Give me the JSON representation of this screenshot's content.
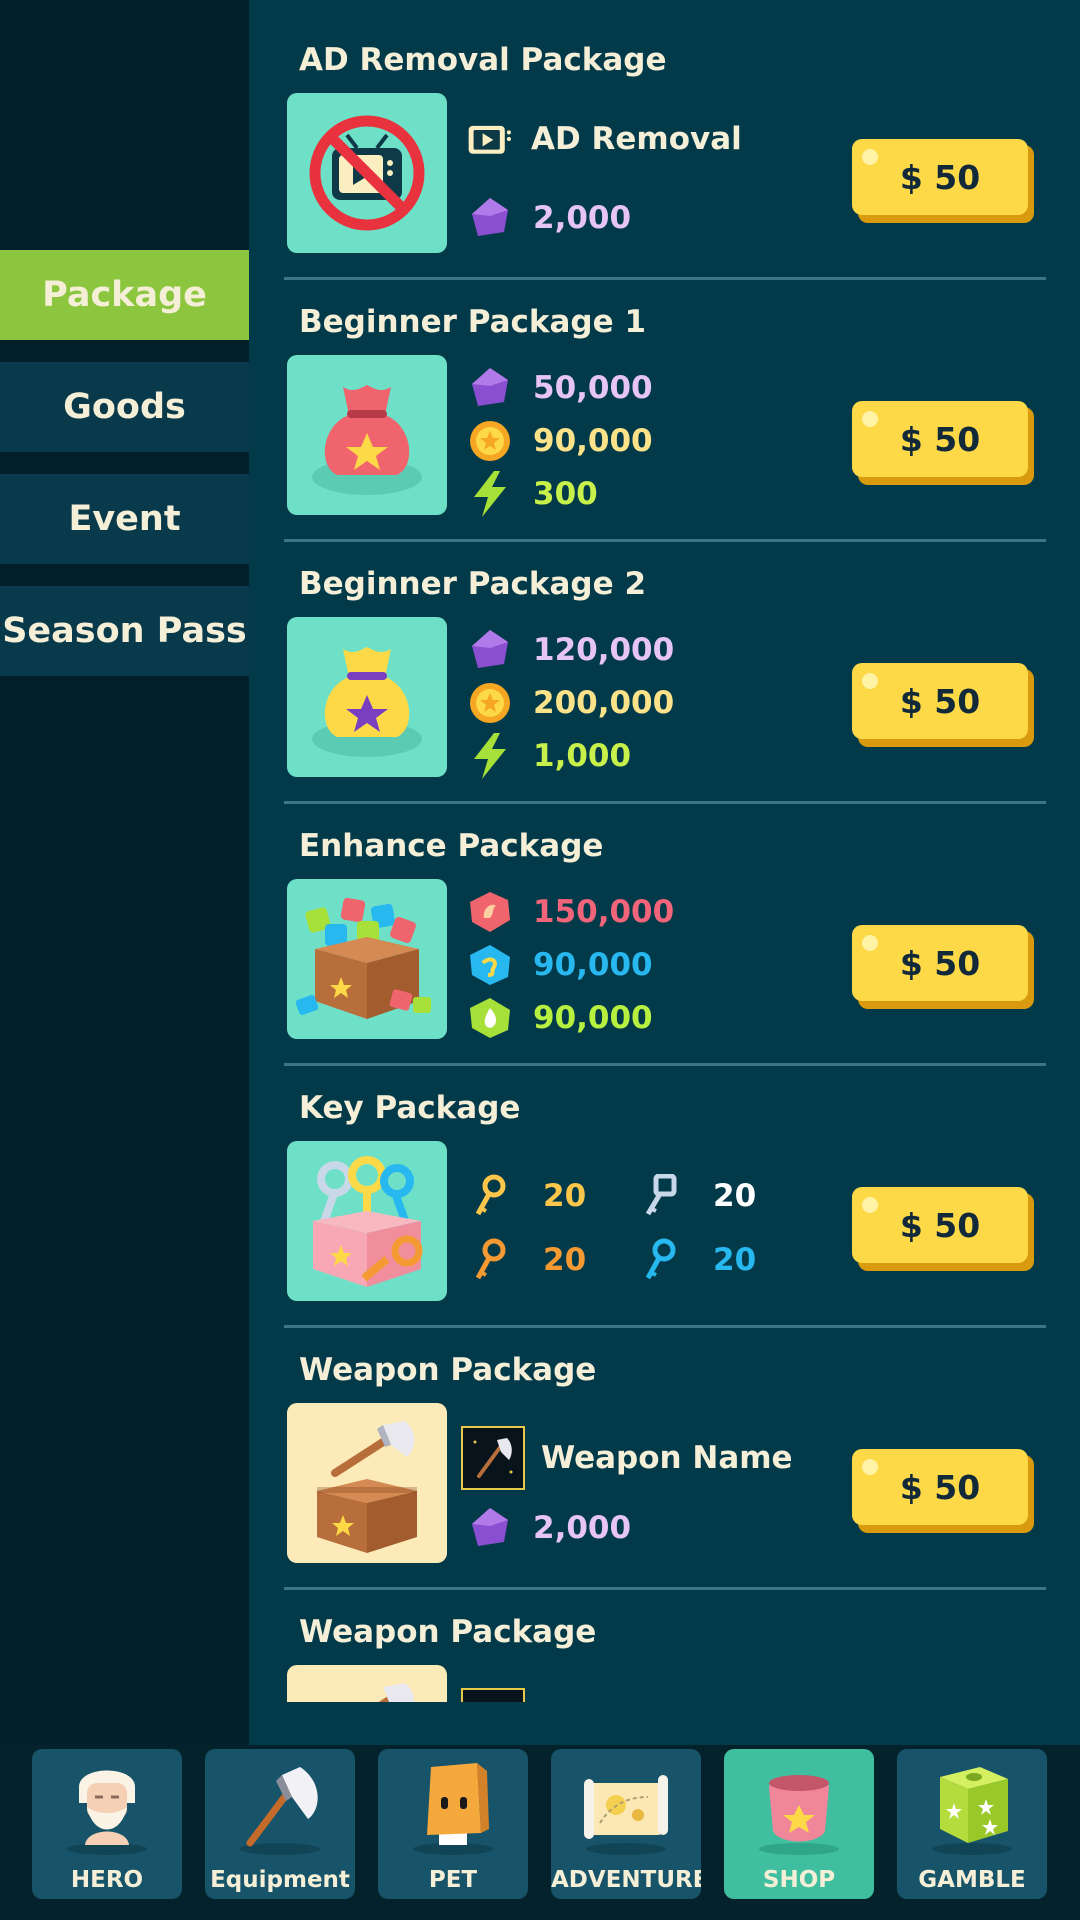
{
  "sidebar": {
    "tabs": [
      {
        "label": "Package",
        "active": true
      },
      {
        "label": "Goods",
        "active": false
      },
      {
        "label": "Event",
        "active": false
      },
      {
        "label": "Season Pass",
        "active": false
      }
    ]
  },
  "packages": [
    {
      "title": "AD Removal Package",
      "thumb": "no-ads-tv-icon",
      "item_label": "AD Removal",
      "gems": "2,000",
      "price": "$ 50"
    },
    {
      "title": "Beginner Package 1",
      "thumb": "red-pouch-icon",
      "gems": "50,000",
      "coins": "90,000",
      "energy": "300",
      "price": "$ 50"
    },
    {
      "title": "Beginner Package 2",
      "thumb": "gold-pouch-icon",
      "gems": "120,000",
      "coins": "200,000",
      "energy": "1,000",
      "price": "$ 50"
    },
    {
      "title": "Enhance Package",
      "thumb": "enhance-box-icon",
      "red_stone": "150,000",
      "blue_stone": "90,000",
      "green_stone": "90,000",
      "price": "$ 50"
    },
    {
      "title": "Key Package",
      "thumb": "key-box-icon",
      "gold_key": "20",
      "silver_key": "20",
      "orange_key": "20",
      "blue_key": "20",
      "price": "$ 50"
    },
    {
      "title": "Weapon Package",
      "thumb": "axe-box-icon",
      "item_label": "Weapon Name",
      "gems": "2,000",
      "price": "$ 50"
    },
    {
      "title": "Weapon Package"
    }
  ],
  "colors": {
    "gem": "#e6c4f5",
    "coin": "#fce38a",
    "energy": "#c8f04a",
    "red_stone": "#f2647a",
    "blue_stone": "#28b8f0",
    "green_stone": "#b8f040",
    "gold_key": "#fcc64a",
    "silver_key": "#ffffff",
    "orange_key": "#f59a32",
    "blue_key": "#28b8f0",
    "active_tab": "#8cc63f",
    "buy_button": "#fdd947"
  },
  "bottom_nav": [
    {
      "label": "HERO",
      "icon": "hero-icon",
      "active": false
    },
    {
      "label": "Equipment",
      "icon": "axe-icon",
      "active": false
    },
    {
      "label": "PET",
      "icon": "pet-icon",
      "active": false
    },
    {
      "label": "ADVENTURE",
      "icon": "map-icon",
      "active": false
    },
    {
      "label": "SHOP",
      "icon": "shop-pouch-icon",
      "active": true
    },
    {
      "label": "GAMBLE",
      "icon": "dice-icon",
      "active": false
    }
  ]
}
